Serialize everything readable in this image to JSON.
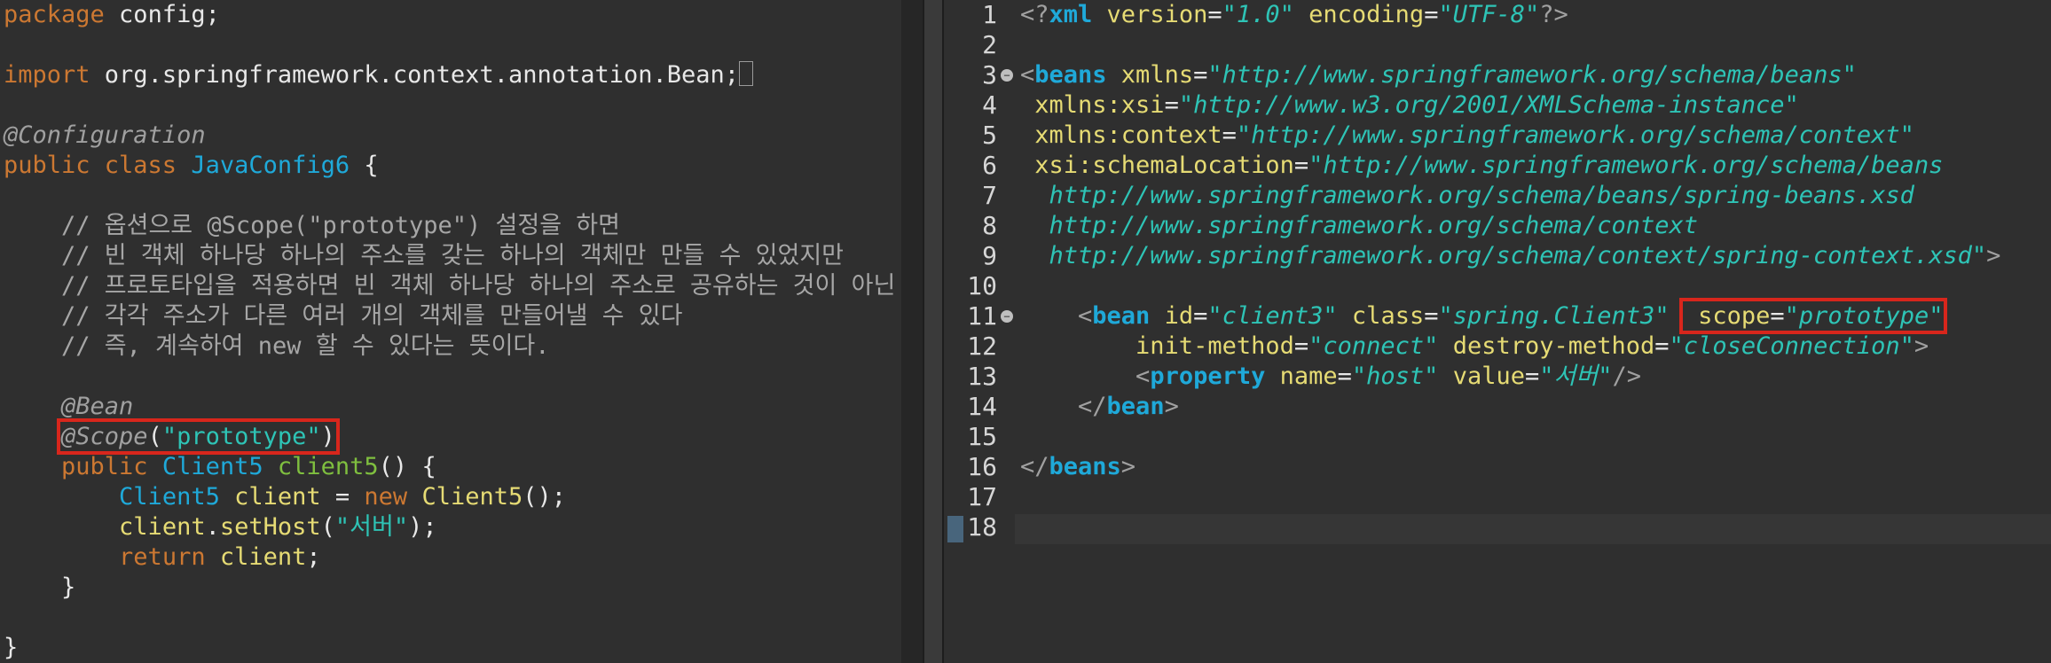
{
  "left": {
    "lines": [
      {
        "segments": [
          {
            "t": "package",
            "c": "kw"
          },
          {
            "t": " config;",
            "c": "plain"
          }
        ]
      },
      {
        "segments": []
      },
      {
        "segments": [
          {
            "t": "import",
            "c": "kw"
          },
          {
            "t": " org.springframework.context.annotation.Bean;",
            "c": "plain"
          }
        ],
        "cursor": true
      },
      {
        "segments": []
      },
      {
        "segments": [
          {
            "t": "@Configuration",
            "c": "ann"
          }
        ]
      },
      {
        "segments": [
          {
            "t": "public class ",
            "c": "kw"
          },
          {
            "t": "JavaConfig6",
            "c": "cls"
          },
          {
            "t": " {",
            "c": "plain"
          }
        ]
      },
      {
        "segments": []
      },
      {
        "segments": [
          {
            "t": "    // 옵션으로 @Scope(\"prototype\") 설정을 하면",
            "c": "cm"
          }
        ]
      },
      {
        "segments": [
          {
            "t": "    // 빈 객체 하나당 하나의 주소를 갖는 하나의 객체만 만들 수 있었지만",
            "c": "cm"
          }
        ]
      },
      {
        "segments": [
          {
            "t": "    // 프로토타입을 적용하면 빈 객체 하나당 하나의 주소로 공유하는 것이 아닌",
            "c": "cm"
          }
        ]
      },
      {
        "segments": [
          {
            "t": "    // 각각 주소가 다른 여러 개의 객체를 만들어낼 수 있다",
            "c": "cm"
          }
        ]
      },
      {
        "segments": [
          {
            "t": "    // 즉, 계속하여 new 할 수 있다는 뜻이다.",
            "c": "cm"
          }
        ]
      },
      {
        "segments": []
      },
      {
        "segments": [
          {
            "t": "    ",
            "c": "plain"
          },
          {
            "t": "@Bean",
            "c": "ann"
          }
        ]
      },
      {
        "segments": [
          {
            "t": "    ",
            "c": "plain"
          },
          {
            "t": "@Scope",
            "c": "ann",
            "hl": "start"
          },
          {
            "t": "(",
            "c": "plain"
          },
          {
            "t": "\"prototype\"",
            "c": "str"
          },
          {
            "t": ")",
            "c": "plain",
            "hl": "end"
          }
        ]
      },
      {
        "segments": [
          {
            "t": "    ",
            "c": "plain"
          },
          {
            "t": "public ",
            "c": "kw"
          },
          {
            "t": "Client5 ",
            "c": "cls"
          },
          {
            "t": "client5",
            "c": "meth"
          },
          {
            "t": "() {",
            "c": "plain"
          }
        ]
      },
      {
        "segments": [
          {
            "t": "        ",
            "c": "plain"
          },
          {
            "t": "Client5 ",
            "c": "cls"
          },
          {
            "t": "client",
            "c": "var"
          },
          {
            "t": " = ",
            "c": "plain"
          },
          {
            "t": "new ",
            "c": "kw"
          },
          {
            "t": "Client5",
            "c": "var"
          },
          {
            "t": "();",
            "c": "plain"
          }
        ]
      },
      {
        "segments": [
          {
            "t": "        ",
            "c": "plain"
          },
          {
            "t": "client",
            "c": "var"
          },
          {
            "t": ".",
            "c": "plain"
          },
          {
            "t": "setHost",
            "c": "var"
          },
          {
            "t": "(",
            "c": "plain"
          },
          {
            "t": "\"서버\"",
            "c": "str"
          },
          {
            "t": ");",
            "c": "plain"
          }
        ]
      },
      {
        "segments": [
          {
            "t": "        ",
            "c": "plain"
          },
          {
            "t": "return ",
            "c": "kw"
          },
          {
            "t": "client",
            "c": "var"
          },
          {
            "t": ";",
            "c": "plain"
          }
        ]
      },
      {
        "segments": [
          {
            "t": "    }",
            "c": "plain"
          }
        ]
      },
      {
        "segments": []
      },
      {
        "segments": [
          {
            "t": "}",
            "c": "plain"
          }
        ]
      }
    ]
  },
  "right": {
    "line_numbers": [
      "1",
      "2",
      "3",
      "4",
      "5",
      "6",
      "7",
      "8",
      "9",
      "10",
      "11",
      "12",
      "13",
      "14",
      "15",
      "16",
      "17",
      "18"
    ],
    "fold_lines": [
      3,
      11
    ],
    "lines": [
      {
        "segments": [
          {
            "t": "<?",
            "c": "tag"
          },
          {
            "t": "xml",
            "c": "kwb"
          },
          {
            "t": " version",
            "c": "attr"
          },
          {
            "t": "=",
            "c": "plain"
          },
          {
            "t": "\"1.0\"",
            "c": "aval"
          },
          {
            "t": " encoding",
            "c": "attr"
          },
          {
            "t": "=",
            "c": "plain"
          },
          {
            "t": "\"UTF-8\"",
            "c": "aval"
          },
          {
            "t": "?>",
            "c": "tag"
          }
        ]
      },
      {
        "segments": []
      },
      {
        "segments": [
          {
            "t": "<",
            "c": "tag"
          },
          {
            "t": "beans",
            "c": "kwb"
          },
          {
            "t": " xmlns",
            "c": "attr"
          },
          {
            "t": "=",
            "c": "plain"
          },
          {
            "t": "\"http://www.springframework.org/schema/beans\"",
            "c": "aval"
          }
        ]
      },
      {
        "segments": [
          {
            "t": " xmlns:xsi",
            "c": "attr"
          },
          {
            "t": "=",
            "c": "plain"
          },
          {
            "t": "\"http://www.w3.org/2001/XMLSchema-instance\"",
            "c": "aval"
          }
        ]
      },
      {
        "segments": [
          {
            "t": " xmlns:context",
            "c": "attr"
          },
          {
            "t": "=",
            "c": "plain"
          },
          {
            "t": "\"http://www.springframework.org/schema/context\"",
            "c": "aval"
          }
        ]
      },
      {
        "segments": [
          {
            "t": " xsi:schemaLocation",
            "c": "attr"
          },
          {
            "t": "=",
            "c": "plain"
          },
          {
            "t": "\"http://www.springframework.org/schema/beans",
            "c": "aval"
          }
        ]
      },
      {
        "segments": [
          {
            "t": "  http://www.springframework.org/schema/beans/spring-beans.xsd",
            "c": "aval"
          }
        ]
      },
      {
        "segments": [
          {
            "t": "  http://www.springframework.org/schema/context",
            "c": "aval"
          }
        ]
      },
      {
        "segments": [
          {
            "t": "  http://www.springframework.org/schema/context/spring-context.xsd\"",
            "c": "aval"
          },
          {
            "t": ">",
            "c": "tag"
          }
        ]
      },
      {
        "segments": []
      },
      {
        "segments": [
          {
            "t": "    <",
            "c": "tag"
          },
          {
            "t": "bean",
            "c": "kwb"
          },
          {
            "t": " id",
            "c": "attr"
          },
          {
            "t": "=",
            "c": "plain"
          },
          {
            "t": "\"client3\"",
            "c": "aval"
          },
          {
            "t": " class",
            "c": "attr"
          },
          {
            "t": "=",
            "c": "plain"
          },
          {
            "t": "\"spring.Client3\"",
            "c": "aval"
          },
          {
            "t": " ",
            "c": "plain"
          },
          {
            "t": " scope",
            "c": "attr",
            "hl": "start"
          },
          {
            "t": "=",
            "c": "plain"
          },
          {
            "t": "\"prototype\"",
            "c": "aval",
            "hl": "end"
          }
        ]
      },
      {
        "segments": [
          {
            "t": "        init-method",
            "c": "attr"
          },
          {
            "t": "=",
            "c": "plain"
          },
          {
            "t": "\"connect\"",
            "c": "aval"
          },
          {
            "t": " destroy-method",
            "c": "attr"
          },
          {
            "t": "=",
            "c": "plain"
          },
          {
            "t": "\"closeConnection\"",
            "c": "aval"
          },
          {
            "t": ">",
            "c": "tag"
          }
        ]
      },
      {
        "segments": [
          {
            "t": "        <",
            "c": "tag"
          },
          {
            "t": "property",
            "c": "kwb"
          },
          {
            "t": " name",
            "c": "attr"
          },
          {
            "t": "=",
            "c": "plain"
          },
          {
            "t": "\"host\"",
            "c": "aval"
          },
          {
            "t": " value",
            "c": "attr"
          },
          {
            "t": "=",
            "c": "plain"
          },
          {
            "t": "\"서버\"",
            "c": "aval"
          },
          {
            "t": "/>",
            "c": "tag"
          }
        ]
      },
      {
        "segments": [
          {
            "t": "    </",
            "c": "tag"
          },
          {
            "t": "bean",
            "c": "kwb"
          },
          {
            "t": ">",
            "c": "tag"
          }
        ]
      },
      {
        "segments": []
      },
      {
        "segments": [
          {
            "t": "</",
            "c": "tag"
          },
          {
            "t": "beans",
            "c": "kwb"
          },
          {
            "t": ">",
            "c": "tag"
          }
        ]
      },
      {
        "segments": []
      },
      {
        "segments": []
      }
    ]
  },
  "colors": {
    "background": "#2f2f2f",
    "highlight_box": "#d8261c",
    "keyword": "#cc7832",
    "type": "#1fa9d9",
    "string": "#2ec4b6"
  }
}
